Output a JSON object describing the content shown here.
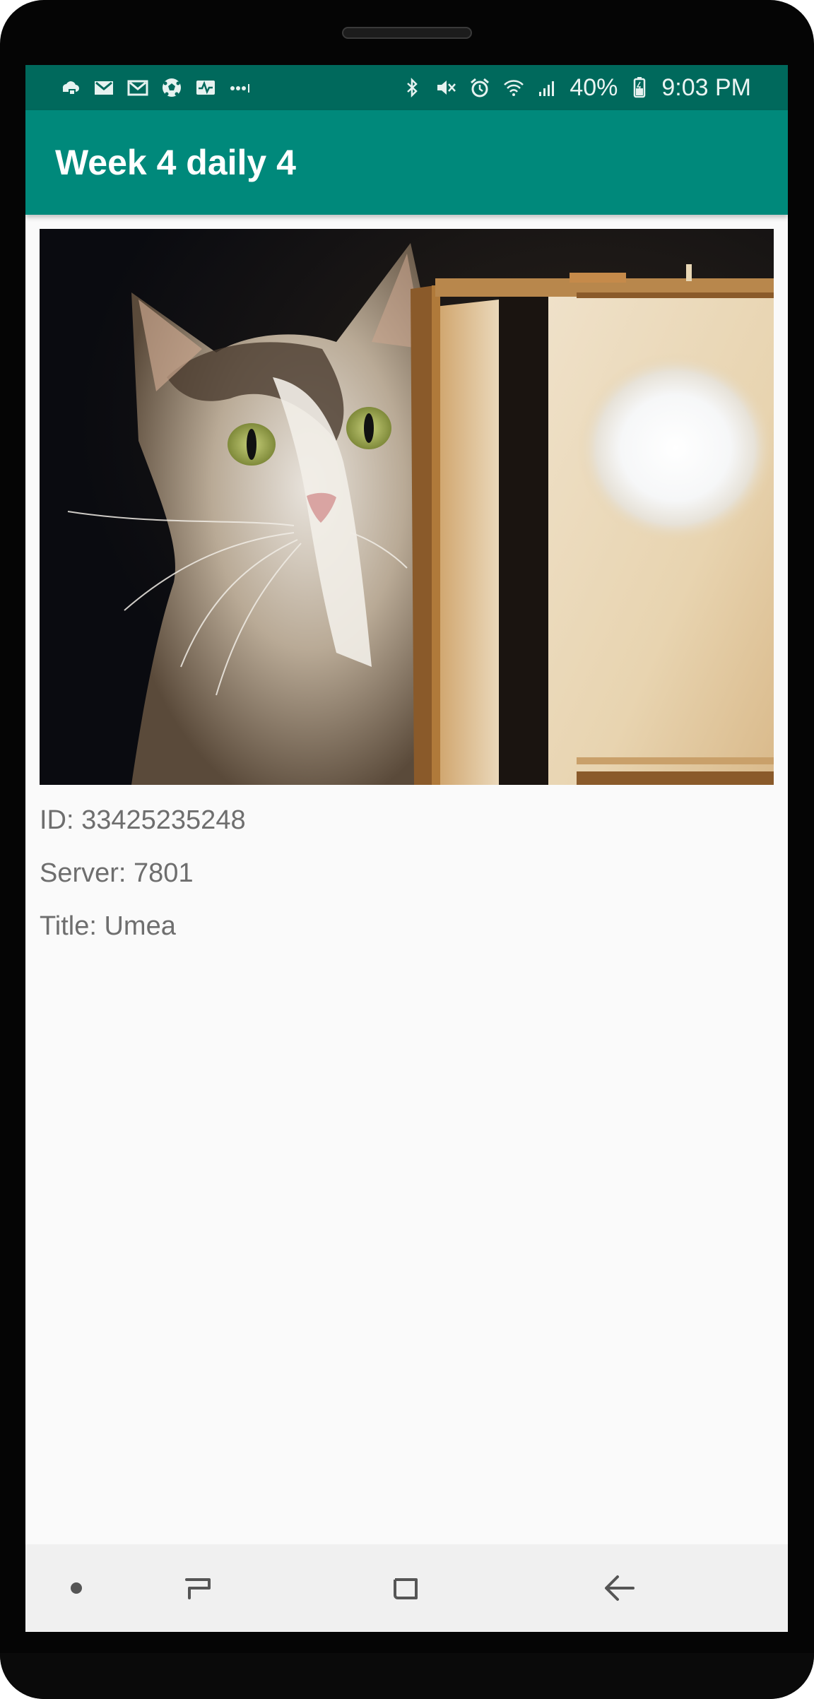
{
  "status_bar": {
    "battery": "40%",
    "time": "9:03 PM",
    "left_icons": [
      "cloud-icon",
      "gmail-icon",
      "gmail-outline-icon",
      "soccer-ball-icon",
      "activity-icon",
      "more-dots-icon"
    ],
    "right_icons": [
      "bluetooth-icon",
      "mute-icon",
      "alarm-icon",
      "wifi-icon",
      "signal-icon",
      "battery-icon"
    ]
  },
  "app_bar": {
    "title": "Week 4 daily 4"
  },
  "photo": {
    "description_icon": "cat-with-lamp-image"
  },
  "details": {
    "id": "ID: 33425235248",
    "server": "Server: 7801",
    "title": "Title: Umea"
  },
  "nav_bar": {
    "buttons": [
      "dot-button",
      "recents-button",
      "home-button",
      "back-button"
    ]
  },
  "colors": {
    "status_bar": "#00695c",
    "app_bar": "#00897b",
    "background": "#fafafa",
    "text": "#6e6e6e"
  }
}
